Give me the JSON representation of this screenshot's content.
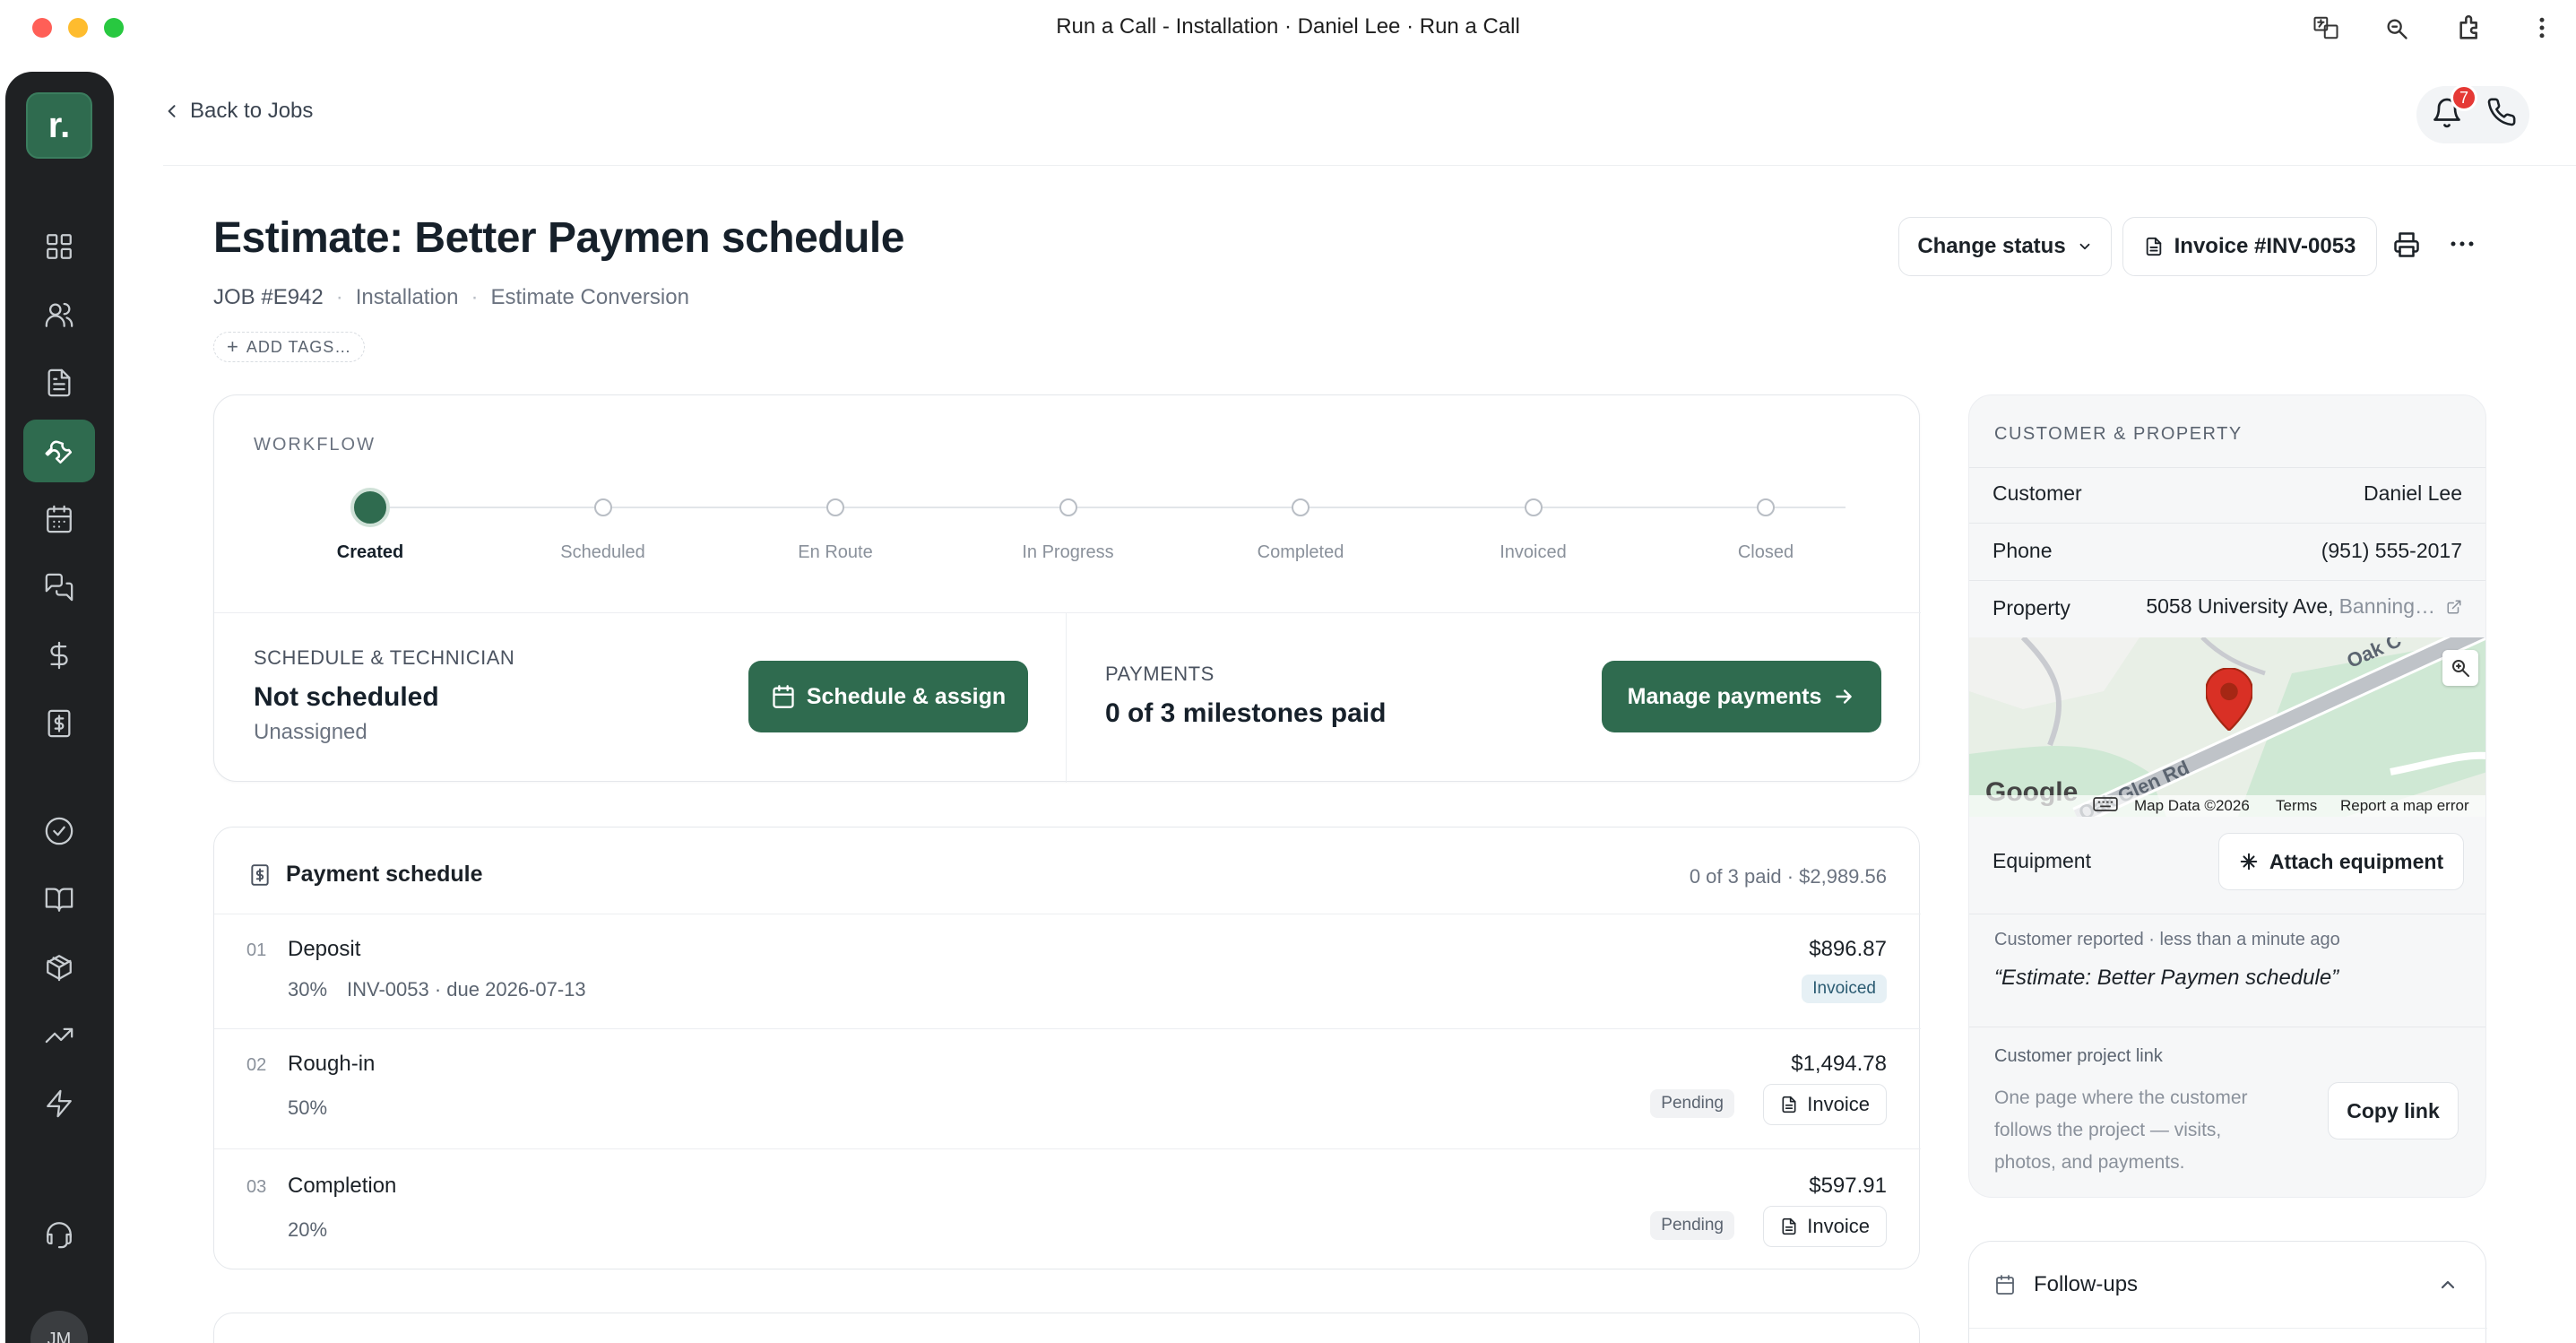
{
  "window": {
    "title": "Run a Call - Installation · Daniel Lee · Run a Call"
  },
  "sidebar": {
    "logo": "r.",
    "items": [
      {
        "name": "dashboard",
        "icon": "grid-icon"
      },
      {
        "name": "customers",
        "icon": "users-icon"
      },
      {
        "name": "documents",
        "icon": "document-icon"
      },
      {
        "name": "jobs",
        "icon": "wrench-icon",
        "active": true
      },
      {
        "name": "calendar",
        "icon": "calendar-icon"
      },
      {
        "name": "messages",
        "icon": "chat-icon"
      },
      {
        "name": "payments",
        "icon": "dollar-icon"
      },
      {
        "name": "invoices",
        "icon": "invoice-icon"
      },
      {
        "name": "tasks",
        "icon": "check-circle-icon"
      },
      {
        "name": "pricebook",
        "icon": "book-icon"
      },
      {
        "name": "inventory",
        "icon": "box-icon"
      },
      {
        "name": "reports",
        "icon": "trending-icon"
      },
      {
        "name": "automations",
        "icon": "bolt-icon"
      },
      {
        "name": "support",
        "icon": "headset-icon"
      }
    ],
    "avatar": "JM"
  },
  "header": {
    "back_label": "Back to Jobs",
    "notification_count": "7"
  },
  "job": {
    "title": "Estimate: Better Paymen schedule",
    "number": "JOB #E942",
    "type": "Installation",
    "source": "Estimate Conversion",
    "add_tags": "ADD TAGS…",
    "change_status": "Change status",
    "invoice": "Invoice #INV-0053"
  },
  "workflow": {
    "caption": "WORKFLOW",
    "steps": [
      "Created",
      "Scheduled",
      "En Route",
      "In Progress",
      "Completed",
      "Invoiced",
      "Closed"
    ],
    "current_index": 0,
    "schedule": {
      "caption": "SCHEDULE & TECHNICIAN",
      "status": "Not scheduled",
      "assignee": "Unassigned",
      "button": "Schedule & assign"
    },
    "payments": {
      "caption": "PAYMENTS",
      "status": "0 of 3 milestones paid",
      "button": "Manage payments"
    }
  },
  "payment_schedule": {
    "title": "Payment schedule",
    "summary": "0 of 3 paid · $2,989.56",
    "milestones": [
      {
        "num": "01",
        "name": "Deposit",
        "amount": "$896.87",
        "percent": "30%",
        "detail": "INV-0053 · due 2026-07-13",
        "status": "Invoiced"
      },
      {
        "num": "02",
        "name": "Rough-in",
        "amount": "$1,494.78",
        "percent": "50%",
        "status": "Pending",
        "action": "Invoice"
      },
      {
        "num": "03",
        "name": "Completion",
        "amount": "$597.91",
        "percent": "20%",
        "status": "Pending",
        "action": "Invoice"
      }
    ]
  },
  "customer_property": {
    "caption": "CUSTOMER & PROPERTY",
    "customer_label": "Customer",
    "customer": "Daniel Lee",
    "phone_label": "Phone",
    "phone": "(951) 555-2017",
    "property_label": "Property",
    "property": "5058 University Ave,",
    "property_city": "Banning…",
    "map": {
      "road_1": "Oak C",
      "road_2": "Oak Glen Rd",
      "google": "Google",
      "attribution": "Map Data ©2026",
      "terms": "Terms",
      "report": "Report a map error"
    },
    "equipment_label": "Equipment",
    "attach_equipment": "Attach equipment",
    "reported_meta": "Customer reported · less than a minute ago",
    "reported_text": "“Estimate: Better Paymen schedule”",
    "project_link_title": "Customer project link",
    "project_link_desc_1": "One page where the customer",
    "project_link_desc_2": "follows the project — visits,",
    "project_link_desc_3": "photos, and payments.",
    "copy_link": "Copy link"
  },
  "followups": {
    "title": "Follow-ups"
  },
  "colors": {
    "brand": "#2f6b4f",
    "sidebar": "#1f2123",
    "alert": "#e53935",
    "map_pin": "#d93025"
  }
}
